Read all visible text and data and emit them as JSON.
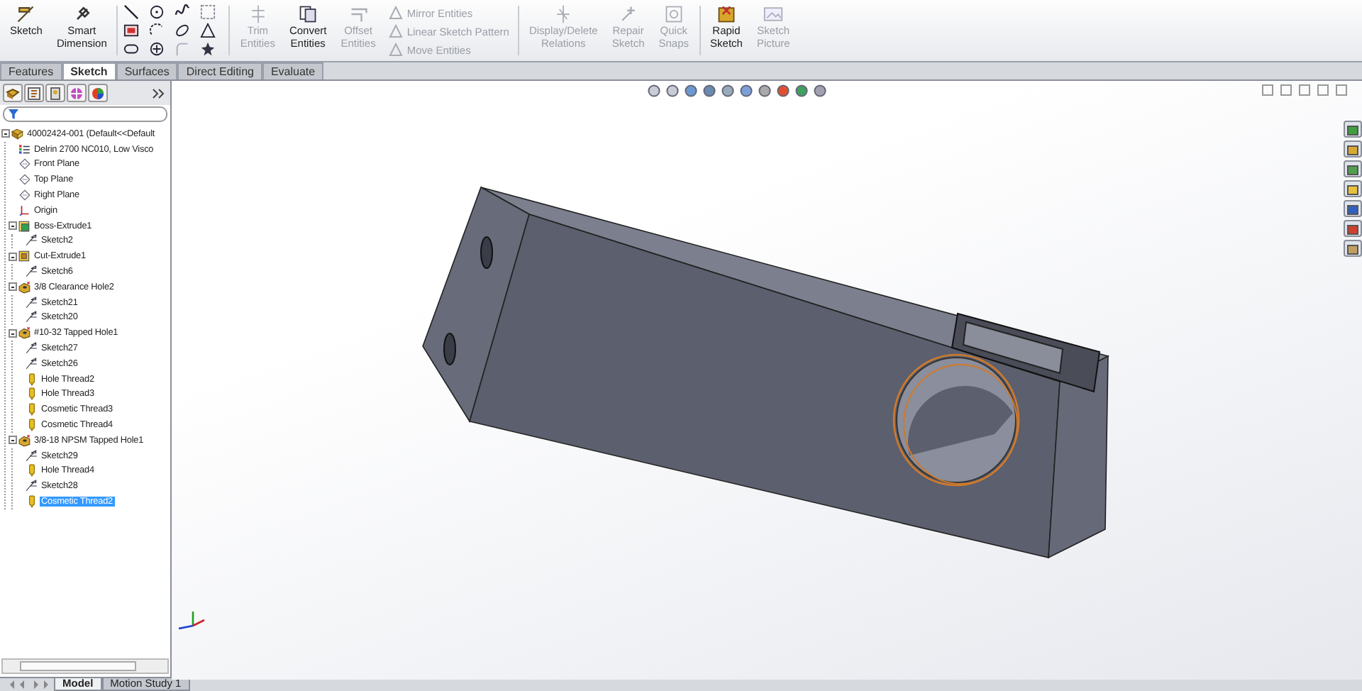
{
  "ribbon": {
    "groups": [
      {
        "kind": "large",
        "label": "Sketch",
        "disabled": false
      },
      {
        "kind": "large",
        "label": "Smart Dimension",
        "disabled": false
      },
      {
        "kind": "grid"
      },
      {
        "kind": "large",
        "label": "Trim Entities",
        "disabled": true
      },
      {
        "kind": "large",
        "label": "Convert Entities",
        "disabled": false
      },
      {
        "kind": "large",
        "label": "Offset Entities",
        "disabled": true
      },
      {
        "kind": "stack",
        "items": [
          {
            "label": "Mirror Entities",
            "disabled": true
          },
          {
            "label": "Linear Sketch Pattern",
            "disabled": true
          },
          {
            "label": "Move Entities",
            "disabled": true
          }
        ]
      },
      {
        "kind": "large",
        "label": "Display/Delete Relations",
        "disabled": true
      },
      {
        "kind": "large",
        "label": "Repair Sketch",
        "disabled": true
      },
      {
        "kind": "large",
        "label": "Quick Snaps",
        "disabled": true
      },
      {
        "kind": "large",
        "label": "Rapid Sketch",
        "disabled": false
      },
      {
        "kind": "large",
        "label": "Sketch Picture",
        "disabled": true
      }
    ]
  },
  "tabs": [
    {
      "label": "Features",
      "selected": false
    },
    {
      "label": "Sketch",
      "selected": true
    },
    {
      "label": "Surfaces",
      "selected": false
    },
    {
      "label": "Direct Editing",
      "selected": false
    },
    {
      "label": "Evaluate",
      "selected": false
    }
  ],
  "feature_tree": {
    "root": {
      "label": "40002424-001  (Default<<Default",
      "kind": "part",
      "expanded": true,
      "selected": false,
      "children": [
        {
          "label": "Delrin 2700 NC010, Low Visco",
          "kind": "material",
          "selected": false
        },
        {
          "label": "Front Plane",
          "kind": "plane",
          "selected": false
        },
        {
          "label": "Top Plane",
          "kind": "plane",
          "selected": false
        },
        {
          "label": "Right Plane",
          "kind": "plane",
          "selected": false
        },
        {
          "label": "Origin",
          "kind": "origin",
          "selected": false
        },
        {
          "label": "Boss-Extrude1",
          "kind": "boss",
          "expanded": true,
          "selected": false,
          "children": [
            {
              "label": "Sketch2",
              "kind": "sketch",
              "selected": false
            }
          ]
        },
        {
          "label": "Cut-Extrude1",
          "kind": "cut",
          "expanded": true,
          "selected": false,
          "children": [
            {
              "label": "Sketch6",
              "kind": "sketch",
              "selected": false
            }
          ]
        },
        {
          "label": "3/8 Clearance Hole2",
          "kind": "hole",
          "expanded": true,
          "selected": false,
          "children": [
            {
              "label": "Sketch21",
              "kind": "sketch",
              "selected": false
            },
            {
              "label": "Sketch20",
              "kind": "sketch",
              "selected": false
            }
          ]
        },
        {
          "label": "#10-32 Tapped Hole1",
          "kind": "hole",
          "expanded": true,
          "selected": false,
          "children": [
            {
              "label": "Sketch27",
              "kind": "sketch",
              "selected": false
            },
            {
              "label": "Sketch26",
              "kind": "sketch",
              "selected": false
            },
            {
              "label": "Hole Thread2",
              "kind": "thread",
              "selected": false
            },
            {
              "label": "Hole Thread3",
              "kind": "thread",
              "selected": false
            },
            {
              "label": "Cosmetic Thread3",
              "kind": "thread",
              "selected": false
            },
            {
              "label": "Cosmetic Thread4",
              "kind": "thread",
              "selected": false
            }
          ]
        },
        {
          "label": "3/8-18 NPSM Tapped Hole1",
          "kind": "hole",
          "expanded": true,
          "selected": false,
          "children": [
            {
              "label": "Sketch29",
              "kind": "sketch",
              "selected": false
            },
            {
              "label": "Hole Thread4",
              "kind": "thread",
              "selected": false
            },
            {
              "label": "Sketch28",
              "kind": "sketch",
              "selected": false
            },
            {
              "label": "Cosmetic Thread2",
              "kind": "thread",
              "selected": true
            }
          ]
        }
      ]
    }
  },
  "bottom_tabs": [
    {
      "label": "Model",
      "selected": true
    },
    {
      "label": "Motion Study 1",
      "selected": false
    }
  ]
}
